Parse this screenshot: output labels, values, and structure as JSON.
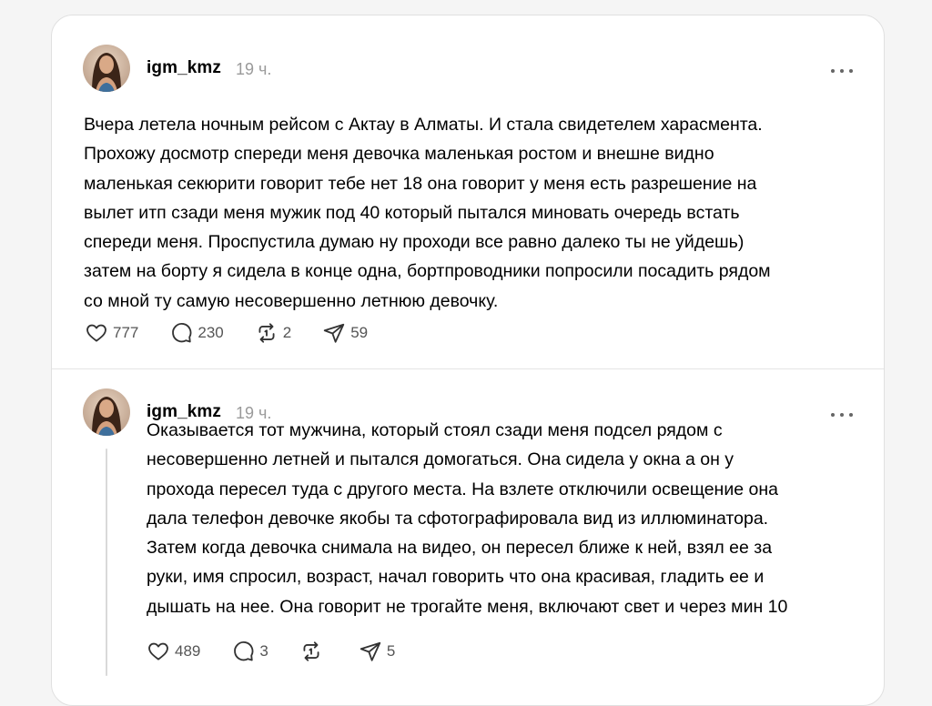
{
  "posts": [
    {
      "username": "igm_kmz",
      "time": "19 ч.",
      "text": "Вчера летела ночным рейсом с Актау в Алматы. И стала свидетелем харасмента.\nПрохожу досмотр спереди меня девочка маленькая ростом и внешне видно\nмаленькая секюрити говорит тебе нет 18 она говорит у меня есть разрешение на\nвылет итп сзади меня мужик под 40 который пытался миновать очередь встать\nспереди меня. Проспустила думаю ну проходи все равно далеко ты не уйдешь)\nзатем на борту я сидела в конце одна, бортпроводники попросили посадить рядом\nсо мной ту самую несовершенно летнюю девочку.",
      "likes": "777",
      "replies": "230",
      "reposts": "2",
      "shares": "59"
    },
    {
      "username": "igm_kmz",
      "time": "19 ч.",
      "text": "Оказывается тот мужчина, который стоял сзади меня подсел рядом с\nнесовершенно летней и пытался домогаться. Она сидела у окна а он у\nпрохода пересел туда с другого места. На взлете отключили освещение она\nдала телефон девочке якобы та сфотографировала вид из иллюминатора.\nЗатем когда девочка снимала на видео, он пересел ближе к ней, взял ее за\nруки, имя спросил, возраст, начал говорить что она красивая, гладить ее и\nдышать на нее. Она говорит не трогайте меня, включают свет и через мин 10",
      "likes": "489",
      "replies": "3",
      "reposts": "",
      "shares": "5"
    }
  ],
  "icons": {
    "like": "heart-icon",
    "reply": "comment-icon",
    "repost": "repost-icon",
    "share": "send-icon",
    "more": "more-icon"
  },
  "colors": {
    "background": "#f5f5f5",
    "card": "#ffffff",
    "secondary_text": "#9a9a9a"
  }
}
